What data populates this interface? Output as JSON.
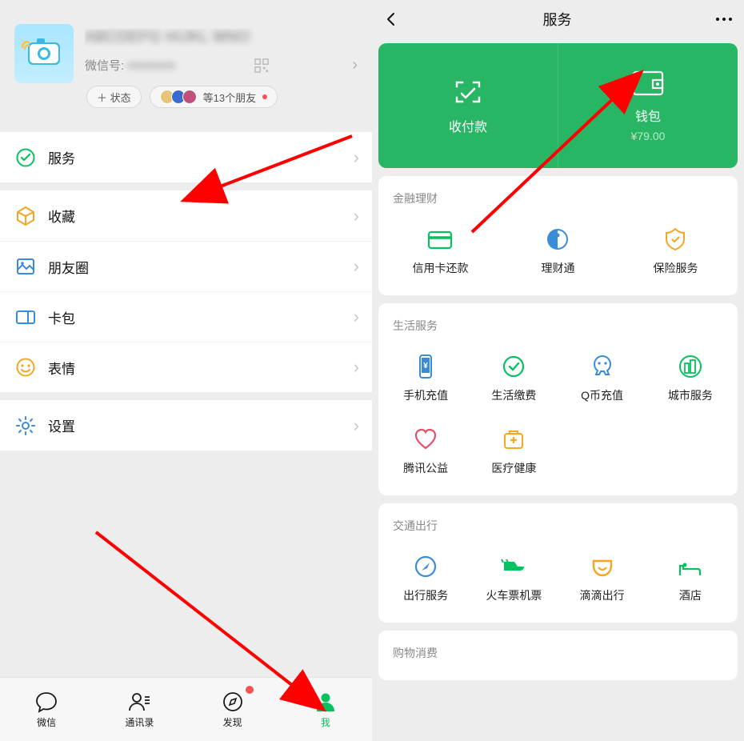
{
  "left": {
    "wxid_label": "微信号:",
    "status_btn": "＋ 状态",
    "friends_text": "等13个朋友",
    "menu": {
      "service": "服务",
      "fav": "收藏",
      "moments": "朋友圈",
      "cards": "卡包",
      "stickers": "表情",
      "settings": "设置"
    },
    "tabs": {
      "chat": "微信",
      "contacts": "通讯录",
      "discover": "发现",
      "me": "我"
    }
  },
  "right": {
    "title": "服务",
    "pay": "收付款",
    "wallet": "钱包",
    "wallet_balance": "¥79.00",
    "sec_finance": "金融理财",
    "finance": {
      "credit": "信用卡还款",
      "licaitong": "理财通",
      "insurance": "保险服务"
    },
    "sec_life": "生活服务",
    "life": {
      "recharge": "手机充值",
      "bills": "生活缴费",
      "qcoin": "Q币充值",
      "city": "城市服务",
      "charity": "腾讯公益",
      "health": "医疗健康"
    },
    "sec_travel": "交通出行",
    "travel": {
      "mobility": "出行服务",
      "train": "火车票机票",
      "didi": "滴滴出行",
      "hotel": "酒店"
    },
    "sec_shop": "购物消费"
  }
}
